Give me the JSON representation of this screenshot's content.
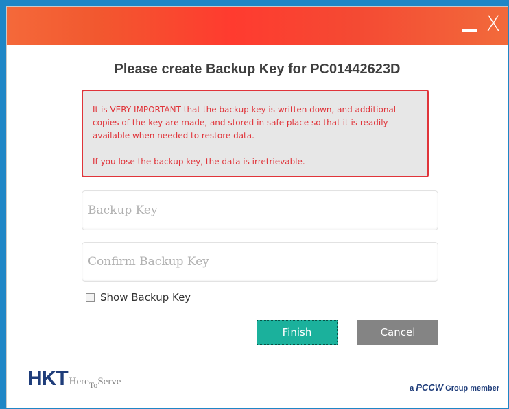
{
  "window": {
    "controls": {
      "minimize_icon": "minimize-icon",
      "close_label": "X"
    }
  },
  "dialog": {
    "heading": "Please create Backup Key for PC01442623D",
    "warning": {
      "paragraph1": "It is VERY IMPORTANT that the backup key is written down, and additional copies of the key are made, and stored in safe place so that it is readily available when needed to restore data.",
      "paragraph2": "If you lose the backup key, the data is irretrievable."
    },
    "backup_key": {
      "placeholder": "Backup Key",
      "value": ""
    },
    "confirm_backup_key": {
      "placeholder": "Confirm Backup Key",
      "value": ""
    },
    "show_backup_key": {
      "label": "Show Backup Key",
      "checked": false
    },
    "finish_label": "Finish",
    "cancel_label": "Cancel"
  },
  "footer": {
    "brand": "HKT",
    "tagline_part1": "Here",
    "tagline_part2": "To",
    "tagline_part3": "Serve",
    "pccw_prefix": "a",
    "pccw_brand": "PCCW",
    "pccw_suffix": "Group member"
  },
  "colors": {
    "accent_finish": "#1bb19c",
    "cancel_gray": "#848484",
    "warning_red": "#e0343a",
    "brand_blue": "#1f3d7a"
  }
}
